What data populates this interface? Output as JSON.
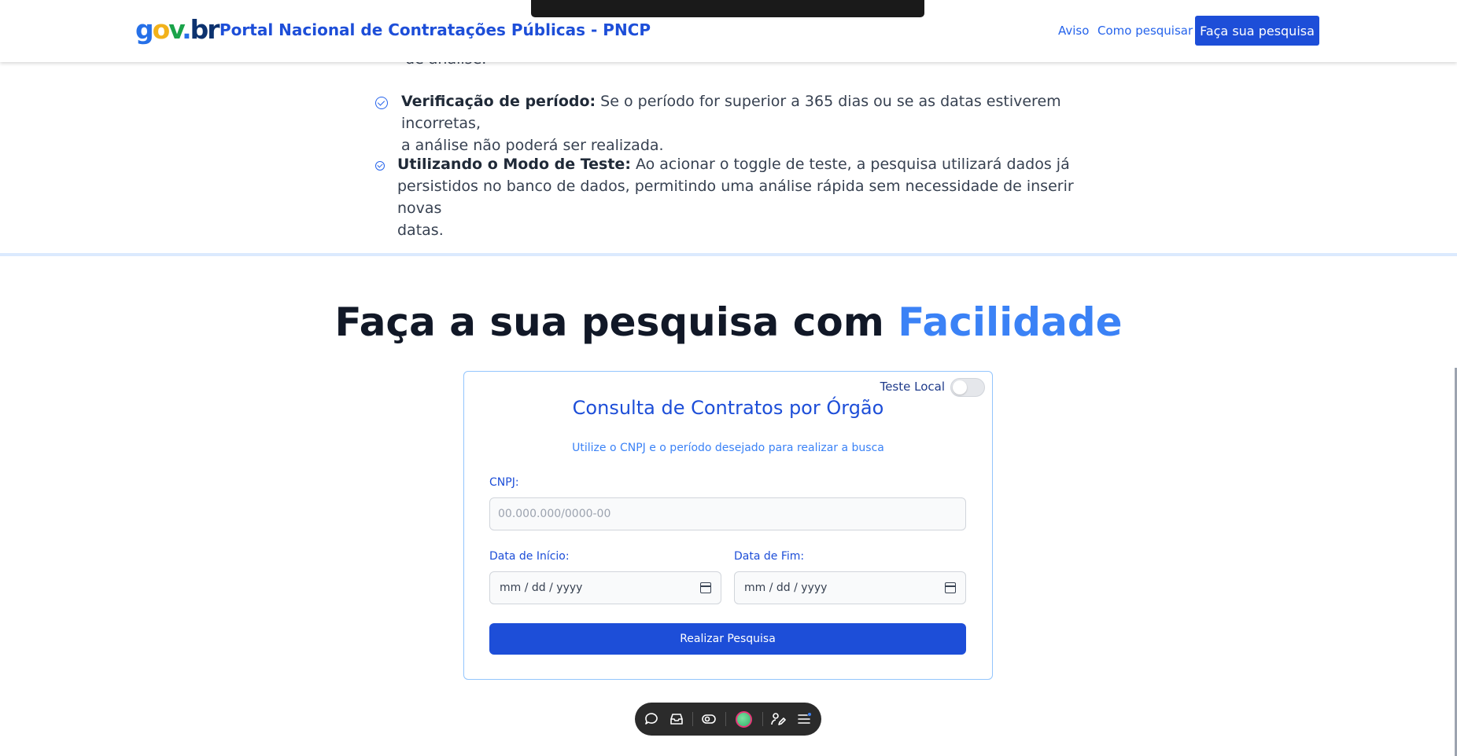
{
  "header": {
    "logo": {
      "g": "g",
      "o": "o",
      "v": "v",
      "dot": ".",
      "br": "br"
    },
    "title": "Portal Nacional de Contratações Públicas - PNCP",
    "nav": [
      {
        "label": "Aviso"
      },
      {
        "label": "Como pesquisar"
      }
    ],
    "cta_label": "Faça sua pesquisa"
  },
  "intro": {
    "cut_line": "de análise.",
    "bullets": [
      {
        "title": "Verificação de período:",
        "line1": " Se o período for superior a 365 dias ou se as datas estiverem incorretas,",
        "line2": "a análise não poderá ser realizada."
      },
      {
        "title": "Utilizando o Modo de Teste:",
        "line1": " Ao acionar o toggle de teste, a pesquisa utilizará dados já",
        "line2": "persistidos no banco de dados, permitindo uma análise rápida sem necessidade de inserir novas",
        "line3": "datas."
      }
    ]
  },
  "section": {
    "title_main": "Faça a sua pesquisa com ",
    "title_accent": "Facilidade"
  },
  "form": {
    "toggle_label": "Teste Local",
    "toggle_on": false,
    "title": "Consulta de Contratos por Órgão",
    "subtitle": "Utilize o CNPJ e o período desejado para realizar a busca",
    "cnpj_label": "CNPJ:",
    "cnpj_placeholder": "00.000.000/0000-00",
    "start_label": "Data de Início:",
    "start_value": "mm / dd / yyyy",
    "end_label": "Data de Fim:",
    "end_value": "mm / dd / yyyy",
    "submit_label": "Realizar Pesquisa"
  },
  "toolbar": {
    "icons": [
      "chat-icon",
      "inbox-icon",
      "eye-toggle-icon",
      "avatar",
      "pen-user-icon",
      "menu-icon"
    ]
  },
  "colors": {
    "primary": "#1d4ed8",
    "accent": "#3b82f6",
    "divider": "#dbeafe"
  }
}
